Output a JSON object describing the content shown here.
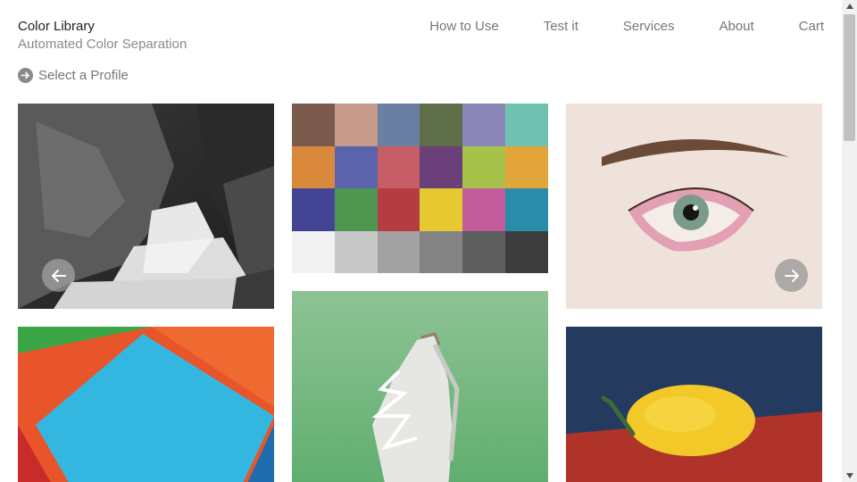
{
  "header": {
    "brand_title": "Color Library",
    "brand_subtitle": "Automated Color Separation"
  },
  "nav": {
    "items": [
      "How to Use",
      "Test it",
      "Services",
      "About",
      "Cart"
    ]
  },
  "profile": {
    "label": "Select a Profile",
    "icon": "arrow-right-circle-icon"
  },
  "gallery": {
    "color_checker": [
      "#7a5a4c",
      "#c69a88",
      "#6a7fa1",
      "#5e6e49",
      "#8a87b8",
      "#6fc2b0",
      "#da883b",
      "#5a63ab",
      "#c65e68",
      "#6a3f7a",
      "#a6c24a",
      "#e1a53a",
      "#434594",
      "#4f9650",
      "#b63c43",
      "#e6c830",
      "#c25c9b",
      "#2a8ca8",
      "#f2f2f2",
      "#c8c8c8",
      "#a2a2a2",
      "#838383",
      "#5f5f5f",
      "#3c3c3c"
    ],
    "carousel_prev_icon": "arrow-left-icon",
    "carousel_next_icon": "arrow-right-icon"
  },
  "scrollbar": {
    "up_icon": "triangle-up-icon",
    "down_icon": "triangle-down-icon"
  }
}
